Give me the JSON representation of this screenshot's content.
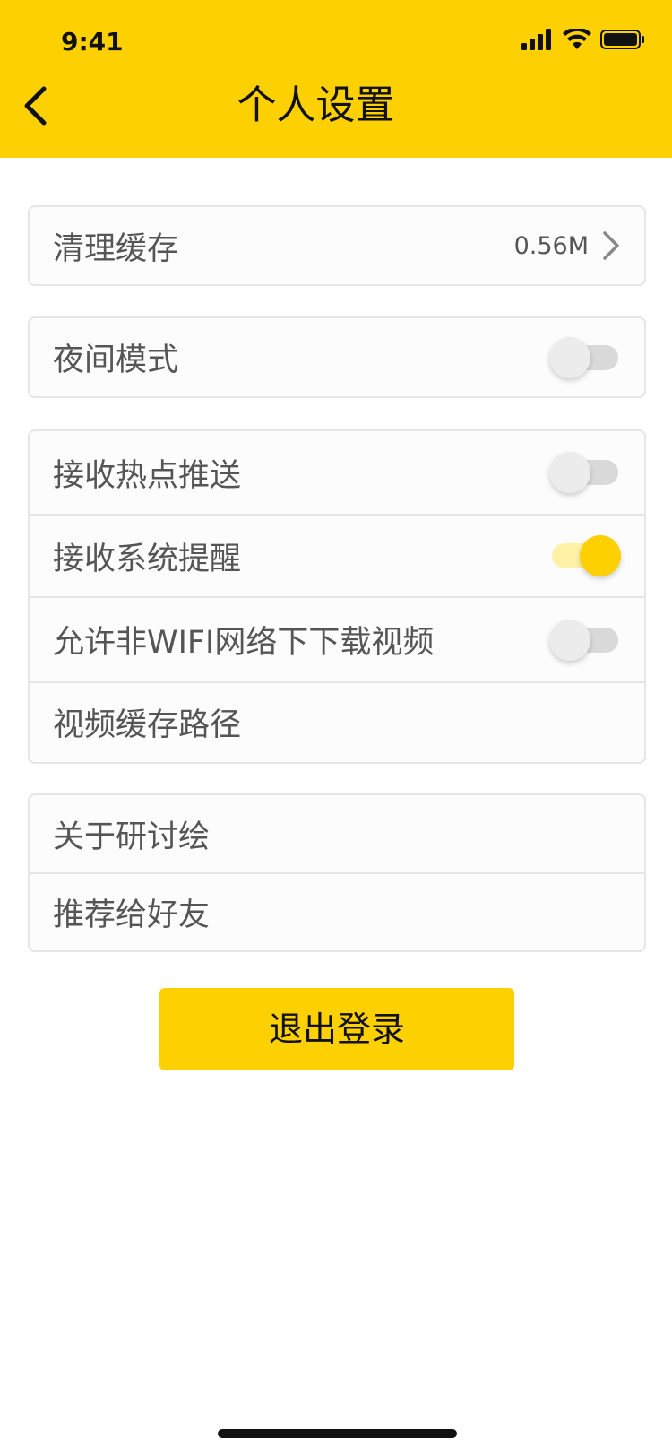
{
  "status_bar": {
    "time": "9:41",
    "icons": [
      "signal-icon",
      "wifi-icon",
      "battery-icon"
    ]
  },
  "header": {
    "title": "个人设置",
    "back_icon": "chevron-left-icon"
  },
  "settings": {
    "clear_cache": {
      "label": "清理缓存",
      "value": "0.56M"
    },
    "night_mode": {
      "label": "夜间模式",
      "enabled": false
    },
    "hot_push": {
      "label": "接收热点推送",
      "enabled": false
    },
    "system_alert": {
      "label": "接收系统提醒",
      "enabled": true
    },
    "non_wifi_download": {
      "label": "允许非WIFI网络下下载视频",
      "enabled": false
    },
    "video_cache_path": {
      "label": "视频缓存路径"
    },
    "about": {
      "label": "关于研讨绘"
    },
    "recommend": {
      "label": "推荐给好友"
    }
  },
  "logout": {
    "label": "退出登录"
  },
  "colors": {
    "accent": "#FCD001",
    "toggle_on_track": "#FFF1A6",
    "toggle_off_track": "#D9D9D9"
  }
}
